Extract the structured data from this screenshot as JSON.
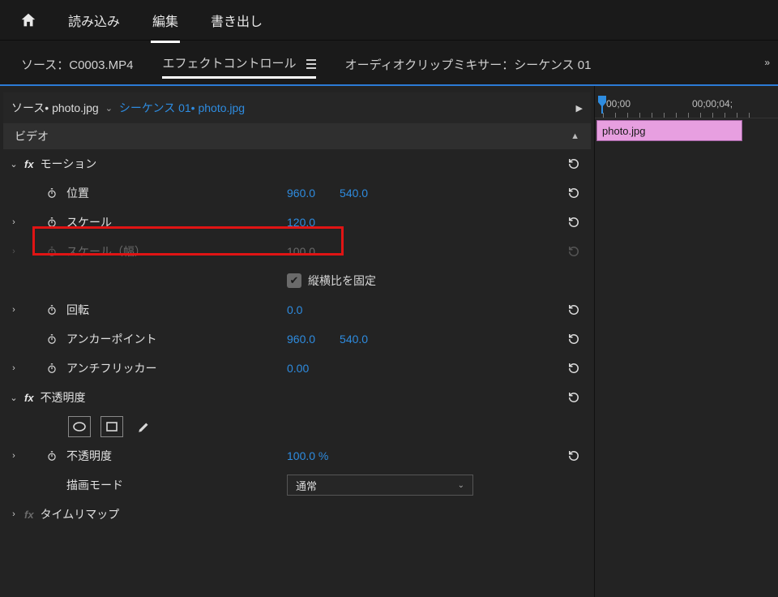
{
  "top_nav": {
    "home_icon": "home-icon",
    "tabs": [
      {
        "label": "読み込み",
        "active": false
      },
      {
        "label": "編集",
        "active": true
      },
      {
        "label": "書き出し",
        "active": false
      }
    ]
  },
  "panel_tabs": {
    "items": [
      {
        "label": "ソース：C0003.MP4",
        "active": false
      },
      {
        "label": "エフェクトコントロール",
        "active": true,
        "menu": true
      },
      {
        "label": "オーディオクリップミキサー：シーケンス 01",
        "active": false
      }
    ]
  },
  "source_row": {
    "source_label": "ソース• photo.jpg",
    "sequence_link": "シーケンス 01• photo.jpg"
  },
  "category_bar": {
    "label": "ビデオ"
  },
  "motion": {
    "header": "モーション",
    "position": {
      "label": "位置",
      "x": "960.0",
      "y": "540.0"
    },
    "scale": {
      "label": "スケール",
      "value": "120.0"
    },
    "scale_w": {
      "label": "スケール（幅）",
      "value": "100.0"
    },
    "uniform": {
      "label": "縦横比を固定",
      "checked": true
    },
    "rotation": {
      "label": "回転",
      "value": "0.0"
    },
    "anchor": {
      "label": "アンカーポイント",
      "x": "960.0",
      "y": "540.0"
    },
    "antiflicker": {
      "label": "アンチフリッカー",
      "value": "0.00"
    }
  },
  "opacity": {
    "header": "不透明度",
    "value_label": "不透明度",
    "value": "100.0 %",
    "blend_mode_label": "描画モード",
    "blend_mode_value": "通常"
  },
  "time_remap": {
    "header": "タイムリマップ"
  },
  "timeline": {
    "timecode_start": "00;00",
    "timecode_end": "00;00;04;",
    "clip_name": "photo.jpg"
  }
}
